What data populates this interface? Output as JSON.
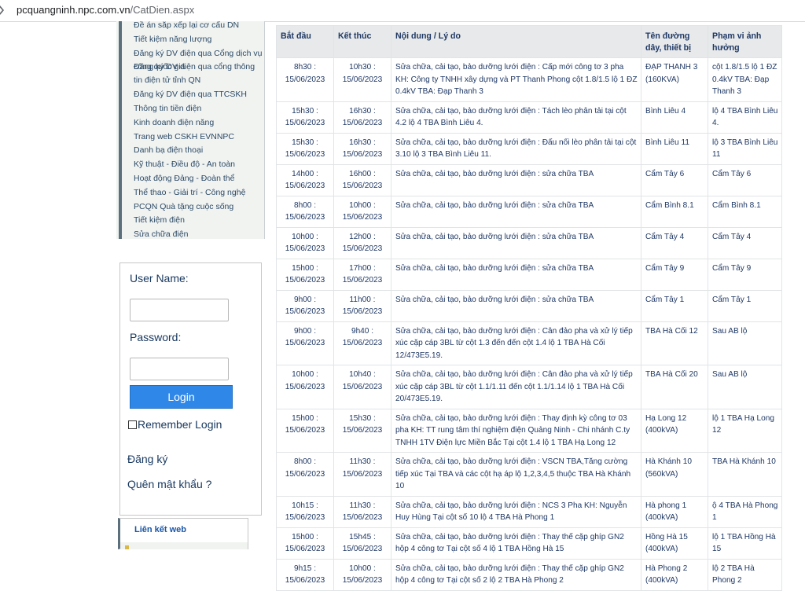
{
  "browser": {
    "url_domain": "pcquangninh.npc.com.vn",
    "url_path": "/CatDien.aspx"
  },
  "sidebar": {
    "items": [
      "Đề án sắp xếp lại cơ cấu DN",
      "Tiết kiệm năng lượng",
      "Đăng ký DV điện qua Cổng dịch vụ công quốc gia",
      "Đăng ký DV điện qua cổng thông tin điện tử tỉnh QN",
      "Đăng ký DV điện qua TTCSKH",
      "Thông tin tiền điện",
      "Kinh doanh điện năng",
      "Trang web CSKH EVNNPC",
      "Danh bạ điện thoại",
      "Kỹ thuật - Điều độ - An toàn",
      "Hoạt động Đảng - Đoàn thể",
      "Thể thao - Giải trí - Công nghệ",
      "PCQN Quà tặng cuộc sống",
      "Tiết kiệm điện",
      "Sửa chữa điện"
    ]
  },
  "login": {
    "username_label": "User Name:",
    "password_label": "Password:",
    "username_value": "",
    "password_value": "",
    "login_button": "Login",
    "remember_label": "Remember Login",
    "register_link": "Đăng ký",
    "forgot_link": "Quên mật khẩu ?"
  },
  "links_box": {
    "title": "Liên kết web"
  },
  "table": {
    "headers": [
      "Bắt đầu",
      "Kết thúc",
      "Nội dung / Lý do",
      "Tên đường dây, thiết bị",
      "Phạm vi ảnh hưởng"
    ],
    "rows": [
      [
        "8h30 : 15/06/2023",
        "10h30 : 15/06/2023",
        "Sửa chữa, cải tạo, bảo dưỡng lưới điện : Cấp mới công tơ 3 pha KH: Công ty TNHH xây dựng và PT Thanh Phong cột 1.8/1.5 lộ 1 ĐZ 0.4kV TBA: Đạp Thanh 3",
        "ĐẠP THANH 3 (160KVA)",
        "cột 1.8/1.5 lộ 1 ĐZ 0.4kV TBA: Đạp Thanh 3"
      ],
      [
        "15h30 : 15/06/2023",
        "16h30 : 15/06/2023",
        "Sửa chữa, cải tạo, bảo dưỡng lưới điện : Tách lèo phân tải tại cột 4.2 lộ 4 TBA Bình Liêu 4.",
        "Bình Liêu 4",
        "lộ 4 TBA Bình Liêu 4."
      ],
      [
        "15h30 : 15/06/2023",
        "16h30 : 15/06/2023",
        "Sửa chữa, cải tạo, bảo dưỡng lưới điện : Đấu nối lèo phân tải tại cột 3.10 lộ 3 TBA Bình Liêu 11.",
        "Bình Liêu 11",
        "lộ 3 TBA Bình Liêu 11"
      ],
      [
        "14h00 : 15/06/2023",
        "16h00 : 15/06/2023",
        "Sửa chữa, cải tạo, bảo dưỡng lưới điện : sửa chữa TBA",
        "Cẩm Tây 6",
        "Cẩm Tây 6"
      ],
      [
        "8h00 : 15/06/2023",
        "10h00 : 15/06/2023",
        "Sửa chữa, cải tạo, bảo dưỡng lưới điện : sửa chữa TBA",
        "Cẩm Bình 8.1",
        "Cẩm Bình 8.1"
      ],
      [
        "10h00 : 15/06/2023",
        "12h00 : 15/06/2023",
        "Sửa chữa, cải tạo, bảo dưỡng lưới điện : sửa chữa TBA",
        "Cẩm Tây 4",
        "Cẩm Tây 4"
      ],
      [
        "15h00 : 15/06/2023",
        "17h00 : 15/06/2023",
        "Sửa chữa, cải tạo, bảo dưỡng lưới điện : sửa chữa TBA",
        "Cẩm Tây 9",
        "Cẩm Tây 9"
      ],
      [
        "9h00 : 15/06/2023",
        "11h00 : 15/06/2023",
        "Sửa chữa, cải tạo, bảo dưỡng lưới điện : sửa chữa TBA",
        "Cẩm Tây 1",
        "Cẩm Tây 1"
      ],
      [
        "9h00 : 15/06/2023",
        "9h40 : 15/06/2023",
        "Sửa chữa, cải tạo, bảo dưỡng lưới điện : Cân đảo pha và xử lý tiếp xúc cặp cáp 3BL từ cột 1.3 đến đến cột 1.4 lộ 1 TBA Hà Cối 12/473E5.19.",
        "TBA Hà Cối 12",
        "Sau AB lộ"
      ],
      [
        "10h00 : 15/06/2023",
        "10h40 : 15/06/2023",
        "Sửa chữa, cải tạo, bảo dưỡng lưới điện : Cân đảo pha và xử lý tiếp xúc cặp cáp 3BL từ cột 1.1/1.11 đến cột 1.1/1.14 lộ 1 TBA Hà Cối 20/473E5.19.",
        "TBA Hà Cối 20",
        "Sau AB lộ"
      ],
      [
        "15h00 : 15/06/2023",
        "15h30 : 15/06/2023",
        "Sửa chữa, cải tạo, bảo dưỡng lưới điện : Thay định kỳ công tơ 03 pha KH: TT rung tâm thí nghiệm điện Quảng Ninh - Chi nhánh C.ty TNHH 1TV Điện lực Miền Bắc Tại cột 1.4 lộ 1 TBA Hạ Long 12",
        "Hạ Long 12 (400kVA)",
        "lộ 1 TBA Hạ Long 12"
      ],
      [
        "8h00 : 15/06/2023",
        "11h30 : 15/06/2023",
        "Sửa chữa, cải tạo, bảo dưỡng lưới điện : VSCN TBA,Tăng cường tiếp xúc Tại TBA và các cột hạ áp lộ 1,2,3,4,5 thuộc TBA Hà Khánh 10",
        "Hà Khánh 10 (560kVA)",
        "TBA Hà Khánh 10"
      ],
      [
        "10h15 : 15/06/2023",
        "11h30 : 15/06/2023",
        "Sửa chữa, cải tạo, bảo dưỡng lưới điện : NCS 3 Pha KH: Nguyễn Huy Hùng Tại cột số 10 lộ 4 TBA Hà Phong 1",
        "Hà phong 1 (400kVA)",
        "ộ 4 TBA Hà Phong 1"
      ],
      [
        "15h00 : 15/06/2023",
        "15h45 : 15/06/2023",
        "Sửa chữa, cải tạo, bảo dưỡng lưới điện : Thay thế cặp ghíp GN2 hộp 4 công tơ Tại cột số 4 lộ 1 TBA Hồng Hà 15",
        "Hồng Hà 15 (400kVA)",
        "lộ 1 TBA Hồng Hà 15"
      ],
      [
        "9h15 : 15/06/2023",
        "10h00 : 15/06/2023",
        "Sửa chữa, cải tạo, bảo dưỡng lưới điện : Thay thế cặp ghíp GN2 hộp 4 công tơ Tại cột số 2 lộ 2 TBA Hà Phong 2",
        "Hà Phong 2 (400kVA)",
        "lộ 2 TBA Hà Phong 2"
      ]
    ]
  }
}
